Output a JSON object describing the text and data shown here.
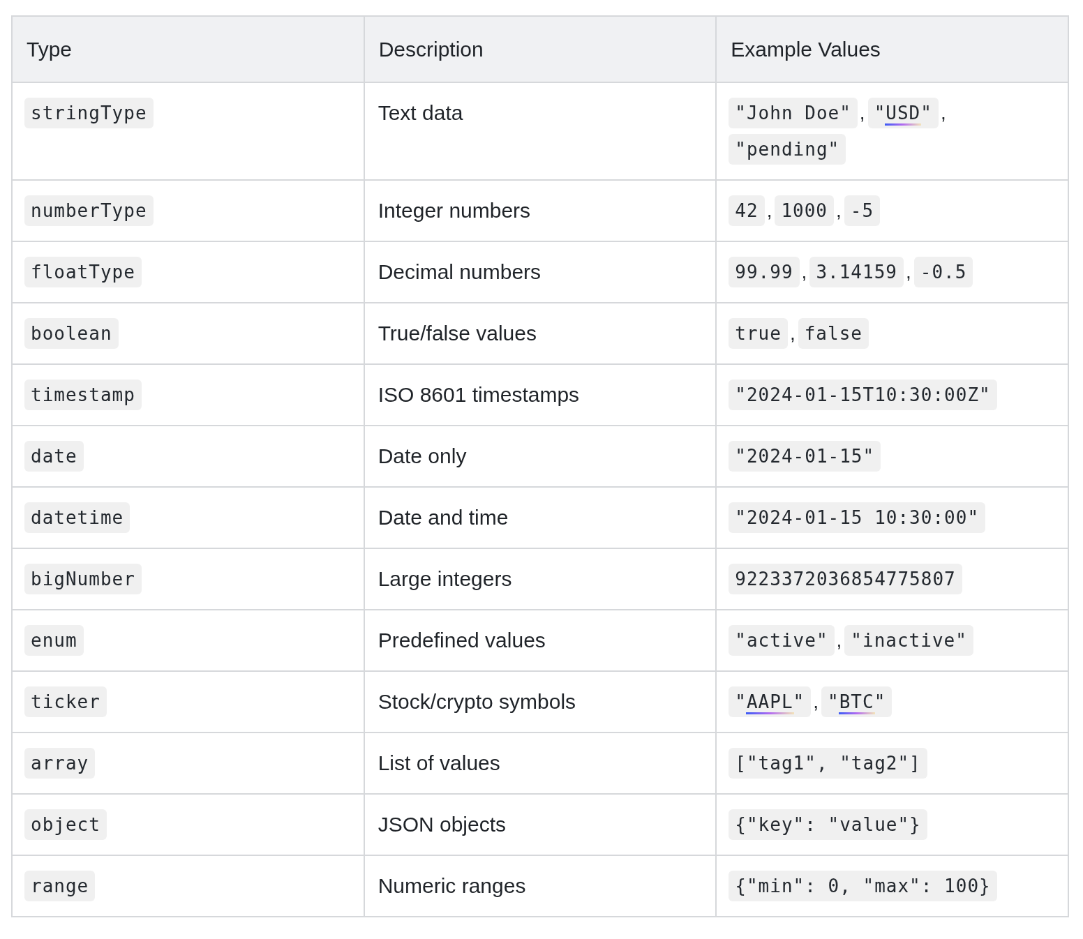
{
  "table": {
    "columns": [
      "Type",
      "Description",
      "Example Values"
    ],
    "separator": ",",
    "rows": [
      {
        "type": "stringType",
        "description": "Text data",
        "examples": [
          {
            "text": "\"John Doe\"",
            "underlined": false
          },
          {
            "text": "\"USD\"",
            "underlined": true
          },
          {
            "text": "\"pending\"",
            "underlined": false
          }
        ]
      },
      {
        "type": "numberType",
        "description": "Integer numbers",
        "examples": [
          {
            "text": "42",
            "underlined": false
          },
          {
            "text": "1000",
            "underlined": false
          },
          {
            "text": "-5",
            "underlined": false
          }
        ]
      },
      {
        "type": "floatType",
        "description": "Decimal numbers",
        "examples": [
          {
            "text": "99.99",
            "underlined": false
          },
          {
            "text": "3.14159",
            "underlined": false
          },
          {
            "text": "-0.5",
            "underlined": false
          }
        ]
      },
      {
        "type": "boolean",
        "description": "True/false values",
        "examples": [
          {
            "text": "true",
            "underlined": false
          },
          {
            "text": "false",
            "underlined": false
          }
        ]
      },
      {
        "type": "timestamp",
        "description": "ISO 8601 timestamps",
        "examples": [
          {
            "text": "\"2024-01-15T10:30:00Z\"",
            "underlined": false
          }
        ]
      },
      {
        "type": "date",
        "description": "Date only",
        "examples": [
          {
            "text": "\"2024-01-15\"",
            "underlined": false
          }
        ]
      },
      {
        "type": "datetime",
        "description": "Date and time",
        "examples": [
          {
            "text": "\"2024-01-15 10:30:00\"",
            "underlined": false
          }
        ]
      },
      {
        "type": "bigNumber",
        "description": "Large integers",
        "examples": [
          {
            "text": "9223372036854775807",
            "underlined": false
          }
        ]
      },
      {
        "type": "enum",
        "description": "Predefined values",
        "examples": [
          {
            "text": "\"active\"",
            "underlined": false
          },
          {
            "text": "\"inactive\"",
            "underlined": false
          }
        ]
      },
      {
        "type": "ticker",
        "description": "Stock/crypto symbols",
        "examples": [
          {
            "text": "\"AAPL\"",
            "underlined": true
          },
          {
            "text": "\"BTC\"",
            "underlined": true
          }
        ]
      },
      {
        "type": "array",
        "description": "List of values",
        "examples": [
          {
            "text": "[\"tag1\", \"tag2\"]",
            "underlined": false
          }
        ]
      },
      {
        "type": "object",
        "description": "JSON objects",
        "examples": [
          {
            "text": "{\"key\": \"value\"}",
            "underlined": false
          }
        ]
      },
      {
        "type": "range",
        "description": "Numeric ranges",
        "examples": [
          {
            "text": "{\"min\": 0, \"max\": 100}",
            "underlined": false
          }
        ]
      }
    ]
  }
}
